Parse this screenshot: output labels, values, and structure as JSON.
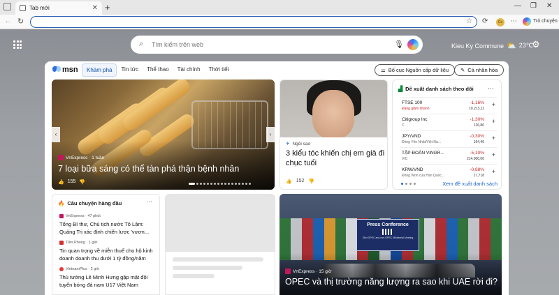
{
  "browser": {
    "tab_title": "Tab mới",
    "tab_close": "✕",
    "new_tab": "+",
    "copilot_label": "Trò chuyện",
    "profile_initials": "Co"
  },
  "header": {
    "search_placeholder": "Tìm kiếm trên web",
    "location": "Kieu Ky Commune",
    "temperature": "23℃"
  },
  "nav": {
    "logo": "msn",
    "tabs": [
      "Khám phá",
      "Tin tức",
      "Thể thao",
      "Tài chính",
      "Thời tiết"
    ],
    "layout_button": "Bố cục Nguồn cấp dữ liệu",
    "personalize_button": "Cá nhân hóa"
  },
  "hero": {
    "source": "VnExpress · 1 tuần",
    "title": "7 loại bữa sáng có thể tàn phá thận bệnh nhân",
    "likes": "155"
  },
  "portrait_card": {
    "source": "Ngôi sao",
    "title": "3 kiểu tóc khiến chị em già đi chục tuổi",
    "likes": "152"
  },
  "watchlist": {
    "title": "Đề xuất danh sách theo dõi",
    "stocks": [
      {
        "name": "FTSE 100",
        "sub": "Đang giảm nhanh",
        "change": "-1,16%",
        "price": "10.213,11"
      },
      {
        "name": "Citigroup Inc",
        "sub": "C",
        "change": "-1,30%",
        "price": "126,86"
      },
      {
        "name": "JPY/VND",
        "sub": "Đồng Yên Nhật/Việt Na...",
        "change": "-0,30%",
        "price": "164,46"
      },
      {
        "name": "TẬP ĐOÀN VINGR...",
        "sub": "VIC",
        "change": "-5,10%",
        "price": "214.000,00"
      },
      {
        "name": "KRW/VND",
        "sub": "Đồng Won của Hàn Quốc...",
        "change": "-0,88%",
        "price": "17,718"
      }
    ],
    "link": "Xem đề xuất danh sách"
  },
  "top_stories": {
    "title": "Câu chuyện hàng đầu",
    "items": [
      {
        "source": "VnExpress · 47 phút",
        "title": "Tổng Bí thư, Chủ tịch nước Tô Lâm: Quảng Trị xác định chiến lược 'vươn..."
      },
      {
        "source": "Tiền Phong · 1 giờ",
        "title": "Tin quan trọng về miễn thuế cho hộ kinh doanh doanh thu dưới 1 tỷ đồng/năm"
      },
      {
        "source": "VietnamPlus · 2 giờ",
        "title": "Thủ tướng Lê Minh Hưng gặp mặt đội tuyển bóng đá nam U17 Việt Nam"
      }
    ]
  },
  "opec_card": {
    "source": "VnExpress · 15 giờ",
    "title": "OPEC và thị trường năng lượng ra sao khi UAE rời đi?",
    "banner_title": "Press Conference",
    "banner_sub": "33rd OPEC and non-OPEC Ministerial Meeting"
  }
}
